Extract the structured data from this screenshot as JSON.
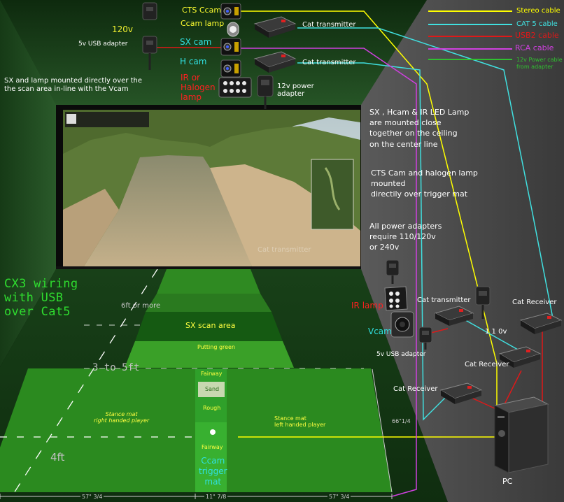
{
  "title": "CX3 wiring\nwith USB\nover Cat5",
  "colors": {
    "stereo": "#ffff00",
    "cat5": "#40e0e0",
    "usb2": "#e01818",
    "rca": "#d040e0",
    "power": "#30c030",
    "floor_green": "#2b8a1f",
    "room_green": "#1d4a1d",
    "wall_grey": "#4a4a4a"
  },
  "legend": [
    {
      "label": "Stereo cable",
      "color": "#ffff00"
    },
    {
      "label": "CAT 5 cable",
      "color": "#40e0e0"
    },
    {
      "label": "USB2 cable",
      "color": "#e01818"
    },
    {
      "label": "RCA cable",
      "color": "#d040e0"
    },
    {
      "label": "12v Power cable\nfrom adapter",
      "color": "#30c030"
    }
  ],
  "top_devices": {
    "cts_ccam": "CTS Ccam",
    "ccam_lamp": "Ccam lamp",
    "volt_120v": "120v",
    "usb_adapter_5v": "5v USB adapter",
    "sx_cam": "SX cam",
    "h_cam": "H cam",
    "ir_halogen": "IR or\nHalogen\nlamp",
    "power_adapter_12v": "12v power\nadapter",
    "cat_transmitter_1": "Cat transmitter",
    "cat_transmitter_2": "Cat transmitter"
  },
  "notes": {
    "sx_lamp_mount": "SX and lamp mounted directly over the\nthe scan area in-line with the Vcam",
    "sx_hcam_ir": "SX , Hcam & IR LED Lamp\nare mounted close\ntogether on the ceiling\non the center line",
    "cts_halogen": "CTS Cam and halogen lamp\nmounted\ndirectily over trigger mat",
    "power_adapters": "All power adapters\nrequire 110/120v\nor 240v"
  },
  "right_devices": {
    "ir_lamp": "IR lamp",
    "vcam": "Vcam",
    "usb_adapter_5v": "5v USB adapter",
    "cat_transmitter": "Cat transmitter",
    "volt_110v": "1 1 0v",
    "cat_receiver_1": "Cat Receiver",
    "cat_receiver_2": "Cat Receiver",
    "cat_receiver_3": "Cat Receiver",
    "pc": "PC"
  },
  "floor": {
    "six_ft": "6ft or more",
    "scan_area": "SX scan area",
    "putting_green": "Putting green",
    "three_to_five": "3 to 5ft",
    "fairway_top": "Fairway",
    "sand": "Sand",
    "rough": "Rough",
    "fairway_bottom": "Fairway",
    "ccam_trigger_mat": "Ccam\ntrigger\nmat",
    "stance_right": "Stance mat\nright handed player",
    "stance_left": "Stance mat\nleft handed player",
    "four_ft": "4ft",
    "dim_66": "66\"1/4",
    "dim_left": "57\" 3/4",
    "dim_center": "11\" 7/8",
    "dim_right": "57\" 3/4"
  },
  "screen": {
    "watermark": "Cat transmitter"
  }
}
